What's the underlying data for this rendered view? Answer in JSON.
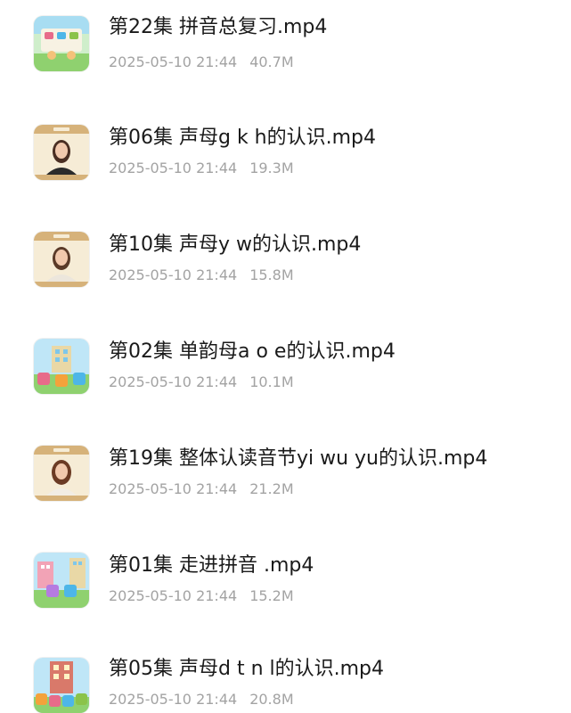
{
  "files": [
    {
      "name": "第22集 拼音总复习.mp4",
      "date": "2025-05-10 21:44",
      "size": "40.7M",
      "thumbnail": "cartoon-classroom-thumb"
    },
    {
      "name": "第06集 声母g k h的认识.mp4",
      "date": "2025-05-10 21:44",
      "size": "19.3M",
      "thumbnail": "presenter-thumb"
    },
    {
      "name": "第10集 声母y w的认识.mp4",
      "date": "2025-05-10 21:44",
      "size": "15.8M",
      "thumbnail": "presenter-thumb"
    },
    {
      "name": "第02集 单韵母a o e的认识.mp4",
      "date": "2025-05-10 21:44",
      "size": "10.1M",
      "thumbnail": "cartoon-letters-thumb"
    },
    {
      "name": "第19集 整体认读音节yi wu yu的认识.mp4",
      "date": "2025-05-10 21:44",
      "size": "21.2M",
      "thumbnail": "presenter-thumb"
    },
    {
      "name": "第01集 走进拼音 .mp4",
      "date": "2025-05-10 21:44",
      "size": "15.2M",
      "thumbnail": "cartoon-letters-thumb"
    },
    {
      "name": "第05集 声母d t n l的认识.mp4",
      "date": "2025-05-10 21:44",
      "size": "20.8M",
      "thumbnail": "cartoon-letters-thumb"
    }
  ]
}
